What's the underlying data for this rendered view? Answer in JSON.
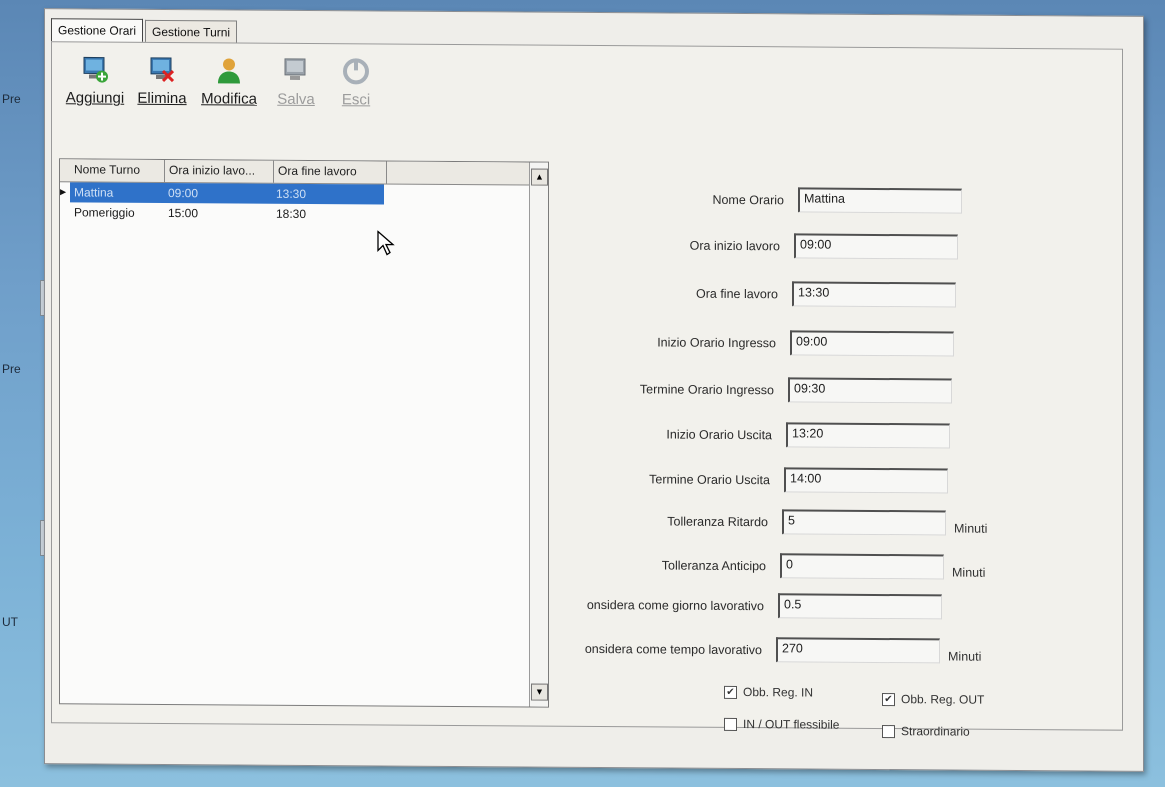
{
  "desktop": {
    "labels": [
      "Pre",
      "Pre",
      "UT"
    ]
  },
  "tabs": [
    {
      "label": "Gestione Orari",
      "active": true
    },
    {
      "label": "Gestione Turni",
      "active": false
    }
  ],
  "toolbar": {
    "add": {
      "label": "Aggiungi",
      "icon": "add-icon"
    },
    "delete": {
      "label": "Elimina",
      "icon": "delete-icon"
    },
    "edit": {
      "label": "Modifica",
      "icon": "user-edit-icon"
    },
    "save": {
      "label": "Salva",
      "icon": "save-icon",
      "disabled": true
    },
    "exit": {
      "label": "Esci",
      "icon": "exit-icon",
      "disabled": true
    }
  },
  "grid": {
    "columns": [
      "Nome Turno",
      "Ora inizio lavo...",
      "Ora fine lavoro"
    ],
    "rows": [
      {
        "name": "Mattina",
        "start": "09:00",
        "end": "13:30",
        "selected": true
      },
      {
        "name": "Pomeriggio",
        "start": "15:00",
        "end": "18:30",
        "selected": false
      }
    ]
  },
  "form": {
    "nome_orario": {
      "label": "Nome Orario",
      "value": "Mattina"
    },
    "ora_inizio": {
      "label": "Ora inizio lavoro",
      "value": "09:00"
    },
    "ora_fine": {
      "label": "Ora fine lavoro",
      "value": "13:30"
    },
    "inizio_ingresso": {
      "label": "Inizio Orario Ingresso",
      "value": "09:00"
    },
    "termine_ingresso": {
      "label": "Termine Orario Ingresso",
      "value": "09:30"
    },
    "inizio_uscita": {
      "label": "Inizio Orario Uscita",
      "value": "13:20"
    },
    "termine_uscita": {
      "label": "Termine Orario Uscita",
      "value": "14:00"
    },
    "tolleranza_ritardo": {
      "label": "Tolleranza Ritardo",
      "value": "5",
      "unit": "Minuti"
    },
    "tolleranza_anticipo": {
      "label": "Tolleranza Anticipo",
      "value": "0",
      "unit": "Minuti"
    },
    "giorno_lavorativo": {
      "label": "onsidera come giorno lavorativo",
      "value": "0.5"
    },
    "tempo_lavorativo": {
      "label": "onsidera come tempo lavorativo",
      "value": "270",
      "unit": "Minuti"
    }
  },
  "checkboxes": {
    "obb_reg_in": {
      "label": "Obb. Reg. IN",
      "checked": true
    },
    "obb_reg_out": {
      "label": "Obb. Reg. OUT",
      "checked": true
    },
    "inout_flessibile": {
      "label": "IN / OUT flessibile",
      "checked": false
    },
    "straordinario": {
      "label": "Straordinario",
      "checked": false
    }
  },
  "colors": {
    "selection": "#2f72c9",
    "desktop": "#6f9ec9"
  }
}
